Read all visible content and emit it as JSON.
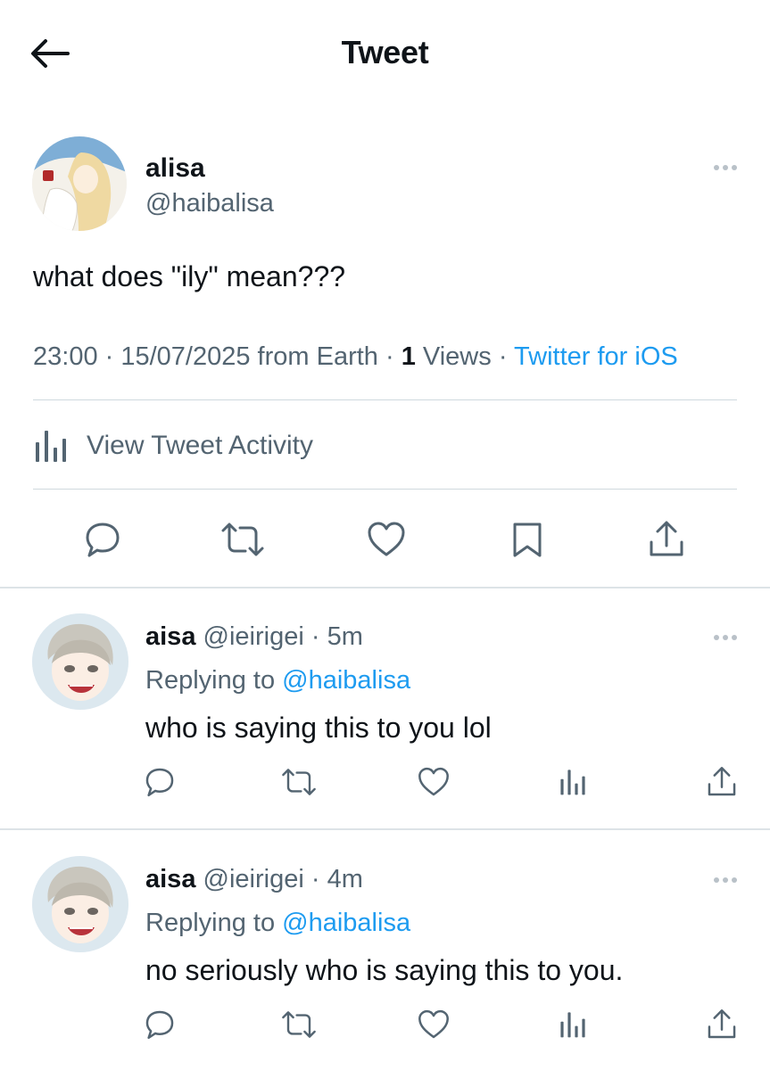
{
  "header": {
    "title": "Tweet",
    "back_icon": "arrow-left-icon"
  },
  "main_tweet": {
    "author_name": "alisa",
    "author_handle": "@haibalisa",
    "text": "what does \"ily\" mean???",
    "time": "23:00",
    "date": "15/07/2025 from Earth",
    "views_count": "1",
    "views_label": "Views",
    "source": "Twitter for iOS",
    "activity_label": "View Tweet Activity",
    "actions": [
      "reply-icon",
      "retweet-icon",
      "like-icon",
      "bookmark-icon",
      "share-icon"
    ]
  },
  "replies": [
    {
      "name": "aisa",
      "handle": "@ieirigei",
      "time": "5m",
      "replying_prefix": "Replying to",
      "replying_to": "@haibalisa",
      "text": "who is saying this to you lol"
    },
    {
      "name": "aisa",
      "handle": "@ieirigei",
      "time": "4m",
      "replying_prefix": "Replying to",
      "replying_to": "@haibalisa",
      "text": "no seriously who is saying this to you."
    }
  ],
  "colors": {
    "text": "#0f1419",
    "secondary": "#536471",
    "link": "#1d9bf0",
    "divider": "#cfd9de"
  }
}
